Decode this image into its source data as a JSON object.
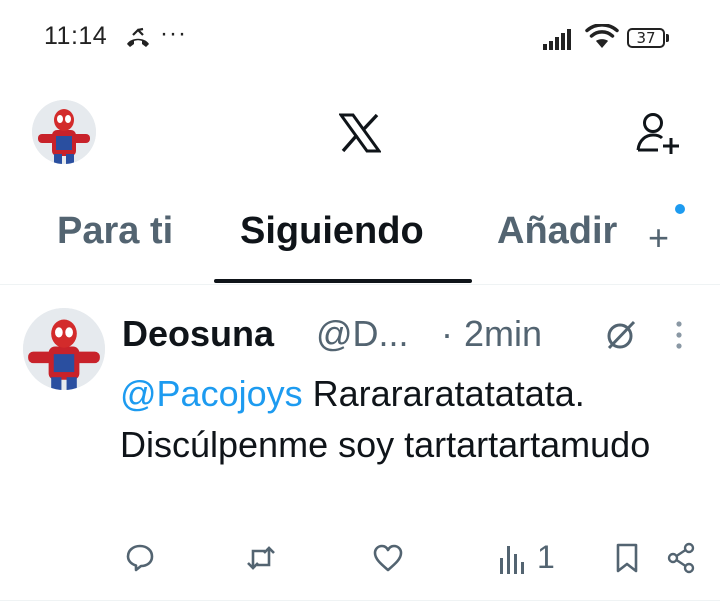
{
  "status_bar": {
    "time": "11:14",
    "more": "···",
    "battery": "37"
  },
  "header": {
    "logo": "x-logo",
    "profile_icon": "spiderman-avatar",
    "add_user_icon": "add-user-icon"
  },
  "tabs": [
    {
      "label": "Para ti",
      "active": false
    },
    {
      "label": "Siguiendo",
      "active": true
    },
    {
      "label": "Añadir",
      "active": false
    }
  ],
  "tab_add_symbol": "+",
  "tweet": {
    "name": "Deosuna",
    "handle": "@D...",
    "separator": "·",
    "time": "2min",
    "mention": "@Pacojoys",
    "text": " Rarararatatatata. Discúlpenme soy tartartartamudo",
    "views": "1"
  },
  "colors": {
    "accent": "#1d9bf0",
    "text_primary": "#0f1419",
    "text_secondary": "#536471"
  }
}
